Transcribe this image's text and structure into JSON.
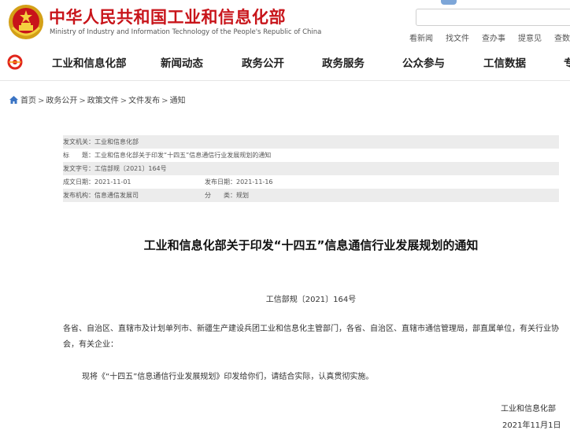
{
  "header": {
    "title_cn": "中华人民共和国工业和信息化部",
    "title_en": "Ministry of Industry and Information Technology of the People's Republic of China",
    "quick_links": [
      "看新闻",
      "找文件",
      "查办事",
      "提意见",
      "查数据"
    ]
  },
  "nav": {
    "items": [
      "工业和信息化部",
      "新闻动态",
      "政务公开",
      "政务服务",
      "公众参与",
      "工信数据",
      "专"
    ]
  },
  "breadcrumb": [
    "首页",
    "政务公开",
    "政策文件",
    "文件发布",
    "通知"
  ],
  "meta": {
    "issuer_label": "发文机关：",
    "issuer": "工业和信息化部",
    "subject_label": "标　　题：",
    "subject": "工业和信息化部关于印发“十四五”信息通信行业发展规划的通知",
    "docno_label": "发文字号：",
    "docno": "工信部规〔2021〕164号",
    "created_label": "成文日期：",
    "created": "2021-11-01",
    "published_label": "发布日期：",
    "published": "2021-11-16",
    "org_label": "发布机构：",
    "org": "信息通信发展司",
    "category_label": "分　　类：",
    "category": "规划"
  },
  "document": {
    "title": "工业和信息化部关于印发“十四五”信息通信行业发展规划的通知",
    "number": "工信部规〔2021〕164号",
    "addressees": "各省、自治区、直辖市及计划单列市、新疆生产建设兵团工业和信息化主管部门，各省、自治区、直辖市通信管理局，部直属单位，有关行业协会，有关企业：",
    "body": "现将《“十四五”信息通信行业发展规划》印发给你们，请结合实际，认真贯彻实施。",
    "signature": "工业和信息化部",
    "date": "2021年11月1日"
  },
  "colors": {
    "brand_red": "#c8141a",
    "nav_accent": "#e1251b"
  }
}
